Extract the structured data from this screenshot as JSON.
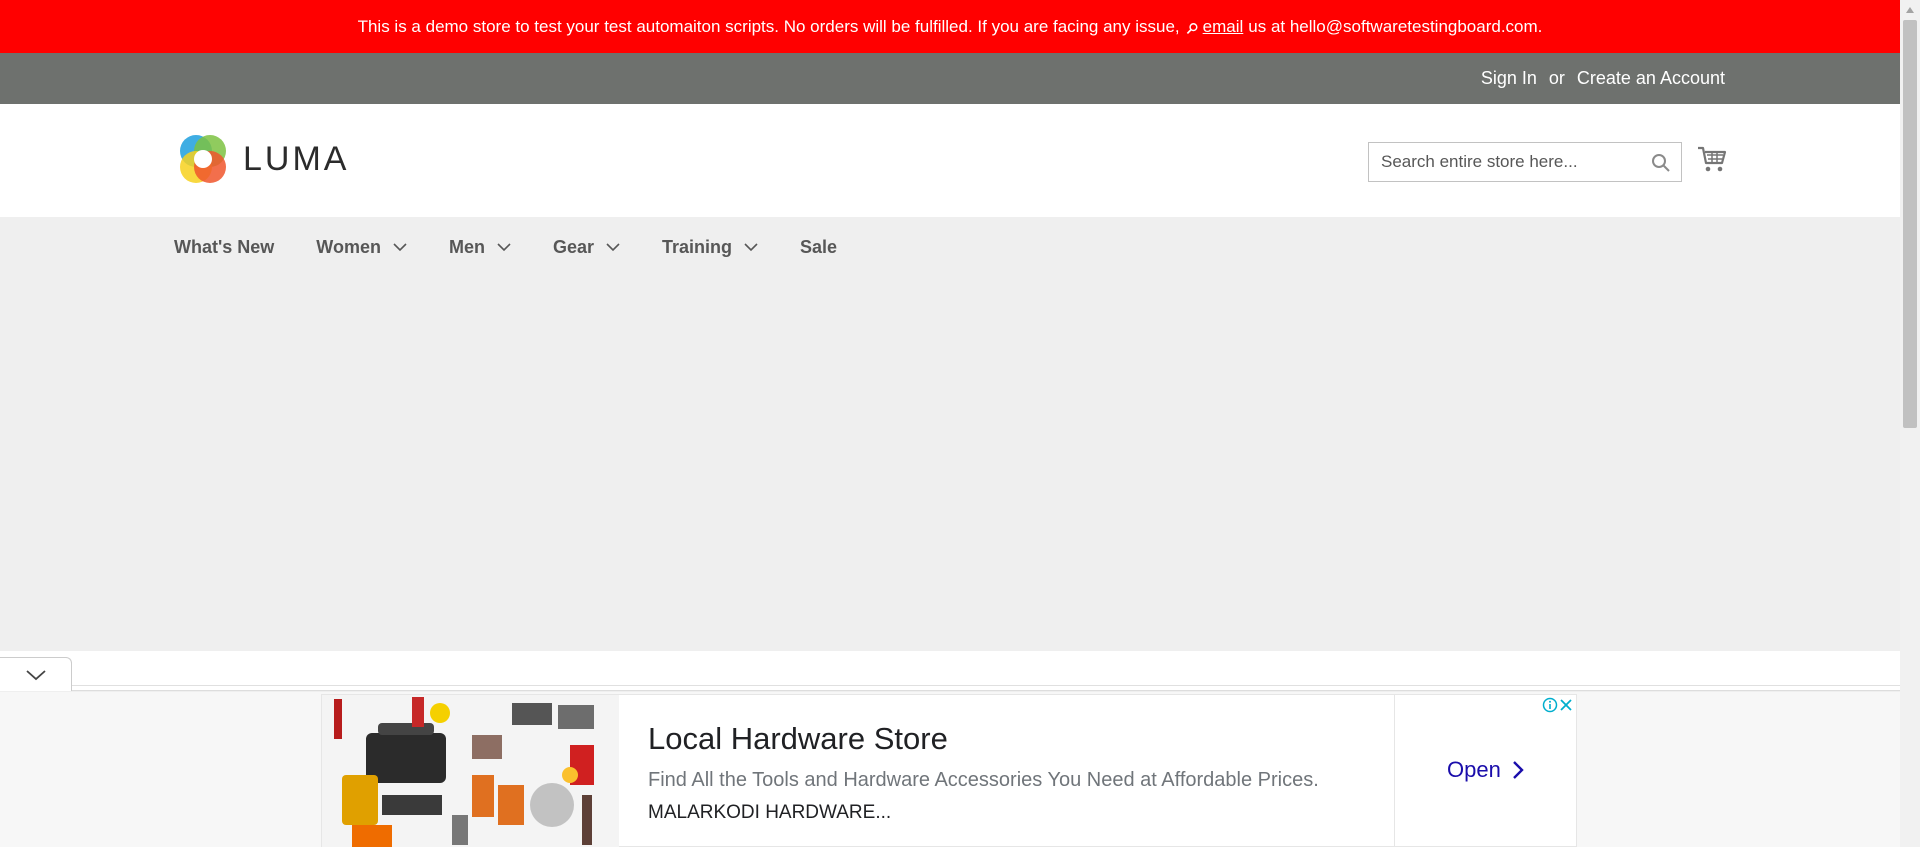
{
  "banner": {
    "text": "This is a demo store to test your test automaiton scripts. No orders will be fulfilled. If you are facing any issue,",
    "email_link": "email",
    "text_after": "us at hello@softwaretestingboard.com."
  },
  "top_links": {
    "sign_in": "Sign In",
    "or": "or",
    "create_account": "Create an Account"
  },
  "logo": {
    "text": "LUMA"
  },
  "search": {
    "placeholder": "Search entire store here..."
  },
  "nav": {
    "items": [
      {
        "label": "What's New",
        "has_dropdown": false
      },
      {
        "label": "Women",
        "has_dropdown": true
      },
      {
        "label": "Men",
        "has_dropdown": true
      },
      {
        "label": "Gear",
        "has_dropdown": true
      },
      {
        "label": "Training",
        "has_dropdown": true
      },
      {
        "label": "Sale",
        "has_dropdown": false
      }
    ]
  },
  "ad": {
    "title": "Local Hardware Store",
    "description": "Find All the Tools and Hardware Accessories You Need at Affordable Prices.",
    "source": "MALARKODI HARDWARE...",
    "cta": "Open"
  },
  "colors": {
    "banner_bg": "#ff0000",
    "top_bar_bg": "#6e716e",
    "page_bg": "#efefef",
    "nav_text": "#575757",
    "ad_link": "#1a0dab"
  },
  "icons": [
    "search-icon",
    "magnifier-icon",
    "cart-icon",
    "chevron-down-icon",
    "ad-info-icon",
    "ad-close-icon"
  ]
}
